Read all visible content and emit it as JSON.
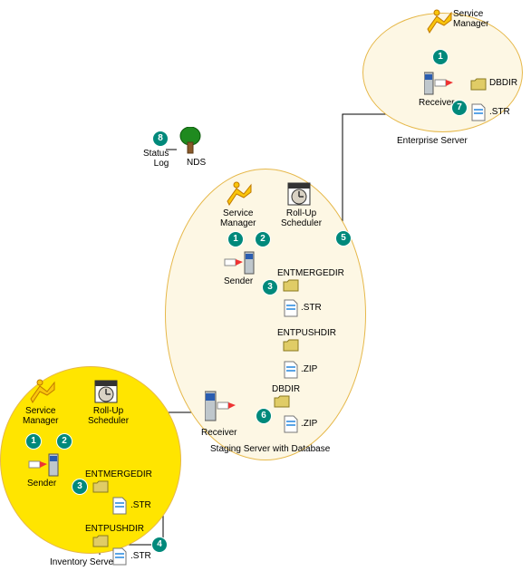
{
  "diagram": {
    "zones": {
      "enterprise": {
        "label": "Enterprise Server"
      },
      "staging": {
        "label": "Staging Server with Database"
      },
      "inventory": {
        "label": "Inventory Server"
      }
    },
    "nodes": {
      "svc_enterprise": {
        "label": "Service\nManager"
      },
      "receiver_enterprise": {
        "label": "Receiver"
      },
      "folder_entdbdir": {
        "label": "DBDIR"
      },
      "doc_entstr": {
        "label": ".STR"
      },
      "svc_staging": {
        "label": "Service\nManager"
      },
      "sched_staging": {
        "label": "Roll-Up\nScheduler"
      },
      "sender_staging": {
        "label": "Sender"
      },
      "folder_entmergedir_staging": {
        "label": "ENTMERGEDIR"
      },
      "doc_str_staging": {
        "label": ".STR"
      },
      "folder_entpushdir_staging": {
        "label": "ENTPUSHDIR"
      },
      "doc_zip_staging": {
        "label": ".ZIP"
      },
      "receiver_staging": {
        "label": "Receiver"
      },
      "folder_dbdir_staging": {
        "label": "DBDIR"
      },
      "doc_zip2_staging": {
        "label": ".ZIP"
      },
      "svc_inventory": {
        "label": "Service\nManager"
      },
      "sched_inventory": {
        "label": "Roll-Up\nScheduler"
      },
      "sender_inventory": {
        "label": "Sender"
      },
      "folder_entmergedir_inv": {
        "label": "ENTMERGEDIR"
      },
      "doc_str_inv": {
        "label": ".STR"
      },
      "folder_entpushdir_inv": {
        "label": "ENTPUSHDIR"
      },
      "doc_str2_inv": {
        "label": ".STR"
      },
      "status_log": {
        "label": "Status\nLog"
      },
      "nds": {
        "label": "NDS"
      }
    },
    "steps": {
      "s1_ent": "1",
      "s7_ent": "7",
      "s1_stg": "1",
      "s2_stg": "2",
      "s3_stg": "3",
      "s5_stg": "5",
      "s6_stg": "6",
      "s1_inv": "1",
      "s2_inv": "2",
      "s3_inv": "3",
      "s4_inv": "4",
      "s8_nds": "8"
    }
  }
}
